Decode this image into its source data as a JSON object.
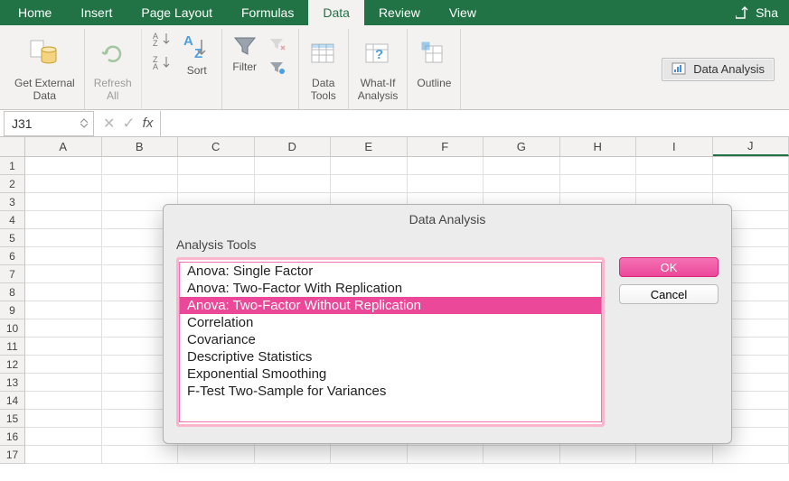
{
  "tabs": {
    "items": [
      "Home",
      "Insert",
      "Page Layout",
      "Formulas",
      "Data",
      "Review",
      "View"
    ],
    "active": "Data",
    "share": "Sha"
  },
  "ribbon": {
    "ext_data": "Get External\nData",
    "refresh": "Refresh\nAll",
    "sort": "Sort",
    "filter": "Filter",
    "data_tools": "Data\nTools",
    "whatif": "What-If\nAnalysis",
    "outline": "Outline",
    "data_analysis": "Data Analysis"
  },
  "formula_bar": {
    "cell_ref": "J31",
    "fx": "fx",
    "value": ""
  },
  "sheet": {
    "columns": [
      "A",
      "B",
      "C",
      "D",
      "E",
      "F",
      "G",
      "H",
      "I",
      "J"
    ],
    "rows": [
      "1",
      "2",
      "3",
      "4",
      "5",
      "6",
      "7",
      "8",
      "9",
      "10",
      "11",
      "12",
      "13",
      "14",
      "15",
      "16",
      "17"
    ]
  },
  "dialog": {
    "title": "Data Analysis",
    "group_label": "Analysis Tools",
    "items": [
      "Anova: Single Factor",
      "Anova: Two-Factor With Replication",
      "Anova: Two-Factor Without Replication",
      "Correlation",
      "Covariance",
      "Descriptive Statistics",
      "Exponential Smoothing",
      "F-Test Two-Sample for Variances"
    ],
    "selected_index": 2,
    "ok": "OK",
    "cancel": "Cancel"
  }
}
